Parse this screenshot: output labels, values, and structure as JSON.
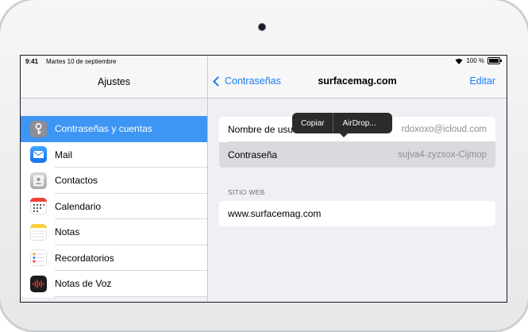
{
  "status_bar": {
    "time": "9:41",
    "date": "Martes 10 de septiembre",
    "battery": "100 %"
  },
  "master": {
    "title": "Ajustes",
    "items": [
      {
        "label": "Contraseñas y cuentas",
        "icon": "key-icon",
        "selected": true
      },
      {
        "label": "Mail",
        "icon": "mail-icon"
      },
      {
        "label": "Contactos",
        "icon": "contacts-icon"
      },
      {
        "label": "Calendario",
        "icon": "calendar-icon"
      },
      {
        "label": "Notas",
        "icon": "notes-icon"
      },
      {
        "label": "Recordatorios",
        "icon": "reminders-icon"
      },
      {
        "label": "Notas de Voz",
        "icon": "voice-memos-icon"
      }
    ]
  },
  "detail": {
    "back_label": "Contraseñas",
    "title": "surfacemag.com",
    "edit_label": "Editar",
    "fields": [
      {
        "label": "Nombre de usuario",
        "label_visible": "Nombre de usu",
        "value": "rdoxoxo@icloud.com"
      },
      {
        "label": "Contraseña",
        "value": "sujva4-zyzsox-Cijmop"
      }
    ],
    "website_header": "SITIO WEB",
    "website": "www.surfacemag.com"
  },
  "popover": {
    "copy_label": "Copiar",
    "airdrop_label": "AirDrop..."
  },
  "colors": {
    "accent": "#1a7cf5",
    "selected_row": "#3d95f4",
    "popover_bg": "#2b2b2b"
  }
}
